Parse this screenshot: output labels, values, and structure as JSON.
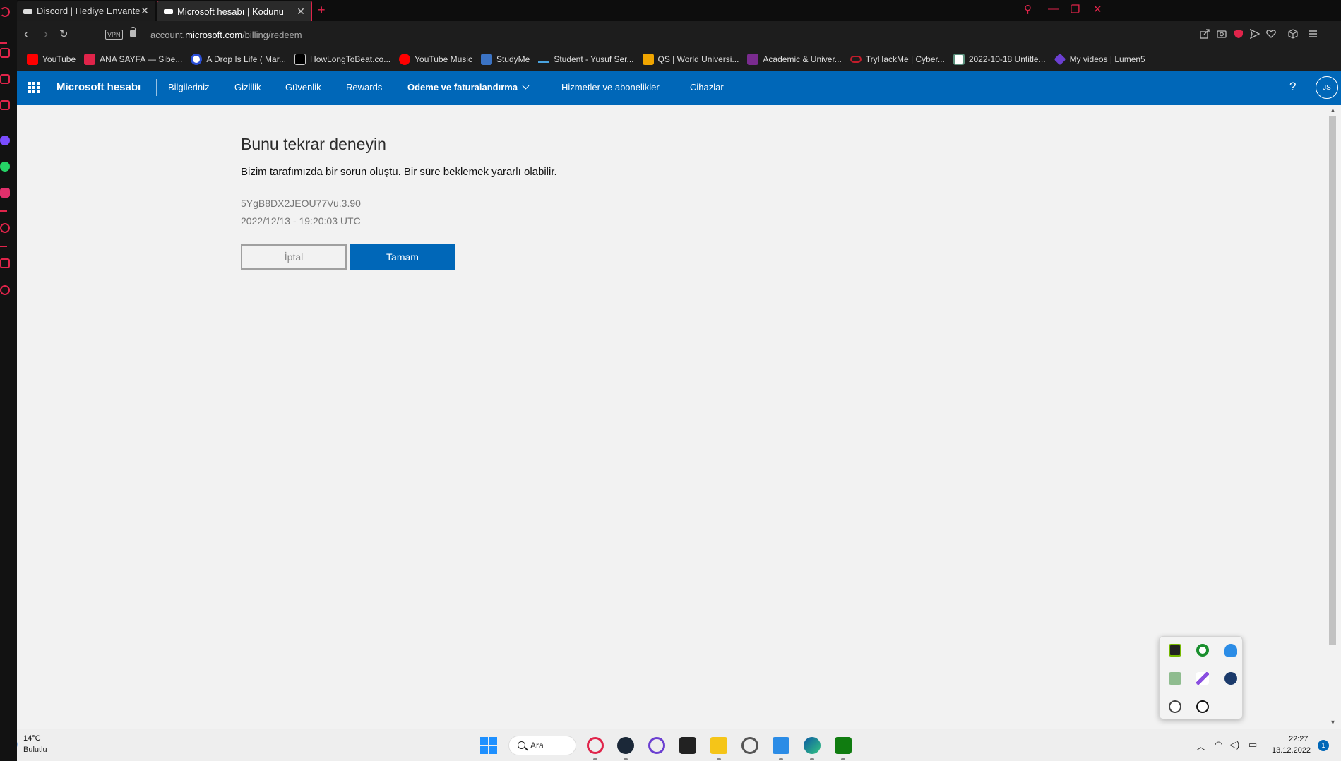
{
  "browser": {
    "tabs": [
      {
        "label": "Discord | Hediye Envanteri",
        "active": false
      },
      {
        "label": "Microsoft hesabı | Kodunu",
        "active": true
      }
    ],
    "url_prefix": "account.",
    "url_domain": "microsoft.com",
    "url_path": "/billing/redeem",
    "vpn_label": "VPN",
    "bookmarks": [
      {
        "label": "YouTube",
        "icon": "youtube-icon",
        "color": "#ff0000"
      },
      {
        "label": "ANA SAYFA — Sibe...",
        "icon": "s-logo-icon",
        "color": "#e0244a"
      },
      {
        "label": "A Drop Is Life ( Mar...",
        "icon": "circle-icon",
        "color": "#2b4fd6"
      },
      {
        "label": "HowLongToBeat.co...",
        "icon": "hltb-icon",
        "color": "#000000"
      },
      {
        "label": "YouTube Music",
        "icon": "youtube-music-icon",
        "color": "#ff0000"
      },
      {
        "label": "StudyMe",
        "icon": "graduation-cap-icon",
        "color": "#3b73c4"
      },
      {
        "label": "Student - Yusuf Ser...",
        "icon": "wave-icon",
        "color": "#4aa3df"
      },
      {
        "label": "QS | World Universi...",
        "icon": "qs-icon",
        "color": "#f0a500"
      },
      {
        "label": "Academic & Univer...",
        "icon": "the-icon",
        "color": "#7a2b8f"
      },
      {
        "label": "TryHackMe | Cyber...",
        "icon": "cloud-icon",
        "color": "#c21d2b"
      },
      {
        "label": "2022-10-18 Untitle...",
        "icon": "doc-icon",
        "color": "#5a8f7b"
      },
      {
        "label": "My videos | Lumen5",
        "icon": "diamond-icon",
        "color": "#6b3fd1"
      }
    ]
  },
  "ms_header": {
    "brand": "Microsoft hesabı",
    "nav": [
      "Bilgileriniz",
      "Gizlilik",
      "Güvenlik",
      "Rewards",
      "Ödeme ve faturalandırma",
      "Hizmetler ve abonelikler",
      "Cihazlar"
    ],
    "help": "?",
    "avatar_initials": "JS"
  },
  "content": {
    "title": "Bunu tekrar deneyin",
    "message": "Bizim tarafımızda bir sorun oluştu. Bir süre beklemek yararlı olabilir.",
    "error_code": "5YgB8DX2JEOU77Vu.3.90",
    "timestamp": "2022/12/13 - 19:20:03 UTC",
    "cancel_label": "İptal",
    "ok_label": "Tamam"
  },
  "taskbar": {
    "temperature": "14°C",
    "weather": "Bulutlu",
    "search_label": "Ara",
    "time": "22:27",
    "date": "13.12.2022",
    "notification_count": "1"
  },
  "colors": {
    "ms_blue": "#0067b8",
    "opera_red": "#e0244a",
    "page_bg": "#f2f2f2"
  }
}
